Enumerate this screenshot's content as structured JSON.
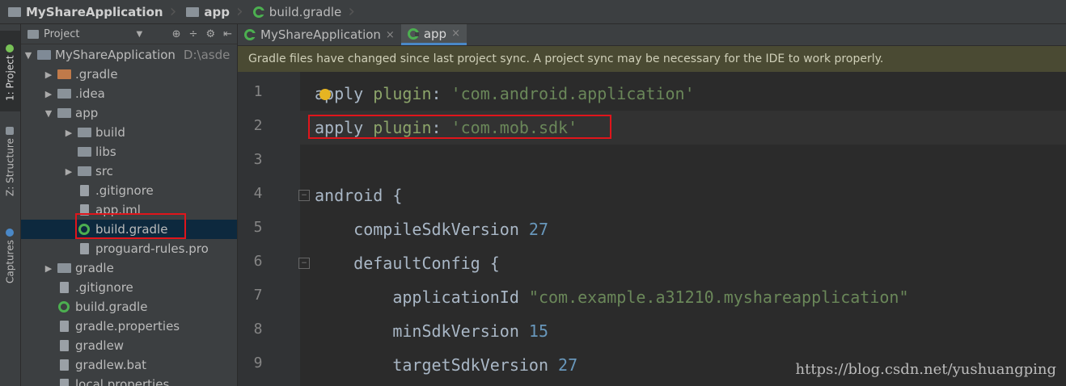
{
  "breadcrumb": {
    "items": [
      "MyShareApplication",
      "app",
      "build.gradle"
    ]
  },
  "toolstrip": {
    "tabs": [
      "1: Project",
      "Z: Structure",
      "Captures"
    ]
  },
  "project_panel": {
    "title": "Project",
    "tree": [
      {
        "label": "MyShareApplication",
        "path": "D:\\asde",
        "arrow": "▼",
        "icon": "project-folder"
      },
      {
        "label": ".gradle",
        "arrow": "▶",
        "icon": "folder-orange"
      },
      {
        "label": ".idea",
        "arrow": "▶",
        "icon": "folder"
      },
      {
        "label": "app",
        "arrow": "▼",
        "icon": "module-folder"
      },
      {
        "label": "build",
        "arrow": "▶",
        "icon": "folder"
      },
      {
        "label": "libs",
        "arrow": "",
        "icon": "folder"
      },
      {
        "label": "src",
        "arrow": "▶",
        "icon": "folder"
      },
      {
        "label": ".gitignore",
        "arrow": "",
        "icon": "file"
      },
      {
        "label": "app.iml",
        "arrow": "",
        "icon": "file"
      },
      {
        "label": "build.gradle",
        "arrow": "",
        "icon": "gradle"
      },
      {
        "label": "proguard-rules.pro",
        "arrow": "",
        "icon": "file"
      },
      {
        "label": "gradle",
        "arrow": "▶",
        "icon": "folder"
      },
      {
        "label": ".gitignore",
        "arrow": "",
        "icon": "file"
      },
      {
        "label": "build.gradle",
        "arrow": "",
        "icon": "gradle"
      },
      {
        "label": "gradle.properties",
        "arrow": "",
        "icon": "file"
      },
      {
        "label": "gradlew",
        "arrow": "",
        "icon": "file"
      },
      {
        "label": "gradlew.bat",
        "arrow": "",
        "icon": "file"
      },
      {
        "label": "local.properties",
        "arrow": "",
        "icon": "file"
      }
    ]
  },
  "editor_tabs": [
    {
      "label": "MyShareApplication",
      "close": "×"
    },
    {
      "label": "app",
      "close": "×"
    }
  ],
  "notice": "Gradle files have changed since last project sync. A project sync may be necessary for the IDE to work properly.",
  "code": {
    "line_numbers": [
      "1",
      "2",
      "3",
      "4",
      "5",
      "6",
      "7",
      "8",
      "9"
    ],
    "lines": [
      {
        "a": "apply ",
        "b": "plugin",
        "c": ": ",
        "d": "'com.android.application'"
      },
      {
        "a": "apply ",
        "b": "plugin",
        "c": ": ",
        "d": "'com.mob.sdk'"
      },
      {
        "a": ""
      },
      {
        "a": "android {"
      },
      {
        "a": "    compileSdkVersion ",
        "n": "27"
      },
      {
        "a": "    defaultConfig {"
      },
      {
        "a": "        applicationId ",
        "s": "\"com.example.a31210.myshareapplication\""
      },
      {
        "a": "        minSdkVersion ",
        "n": "15"
      },
      {
        "a": "        targetSdkVersion ",
        "n": "27"
      }
    ]
  },
  "watermark": "https://blog.csdn.net/yushuangping",
  "colors": {
    "highlight_box": "#e0151b",
    "accent": "#4a88c7"
  }
}
